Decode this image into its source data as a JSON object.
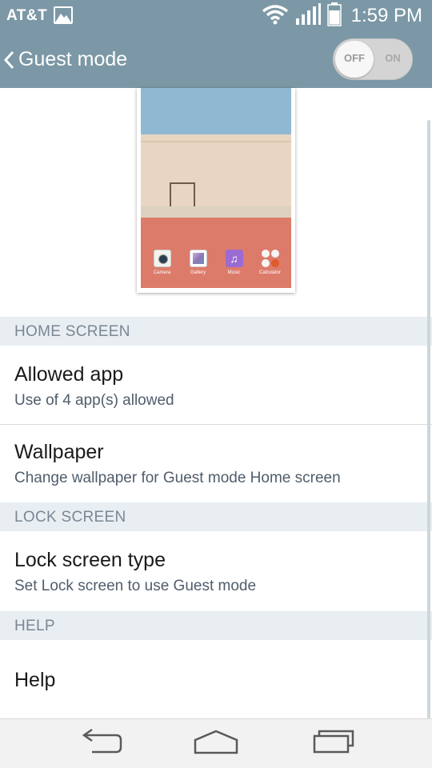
{
  "status_bar": {
    "carrier": "AT&T",
    "time": "1:59 PM",
    "icons": [
      "image-icon",
      "wifi-icon",
      "signal-icon",
      "battery-icon"
    ]
  },
  "action_bar": {
    "title": "Guest mode",
    "toggle": {
      "off_label": "OFF",
      "on_label": "ON",
      "state": "OFF"
    }
  },
  "preview": {
    "apps": [
      {
        "label": "Camera",
        "icon": "camera-icon"
      },
      {
        "label": "Gallery",
        "icon": "gallery-icon"
      },
      {
        "label": "Music",
        "icon": "music-icon"
      },
      {
        "label": "Calculator",
        "icon": "calculator-icon"
      }
    ]
  },
  "sections": {
    "home_screen": "HOME SCREEN",
    "lock_screen": "LOCK SCREEN",
    "help": "HELP"
  },
  "items": {
    "allowed_app": {
      "title": "Allowed app",
      "subtitle": "Use of 4 app(s) allowed"
    },
    "wallpaper": {
      "title": "Wallpaper",
      "subtitle": "Change wallpaper for Guest mode Home screen"
    },
    "lock_screen_type": {
      "title": "Lock screen type",
      "subtitle": "Set Lock screen to use Guest mode"
    },
    "help": {
      "title": "Help"
    }
  },
  "colors": {
    "header": "#7c98a6",
    "section_bg": "#e8eef2",
    "section_text": "#7b8793"
  },
  "nav_bar": [
    "back-icon",
    "home-icon",
    "recent-apps-icon"
  ]
}
